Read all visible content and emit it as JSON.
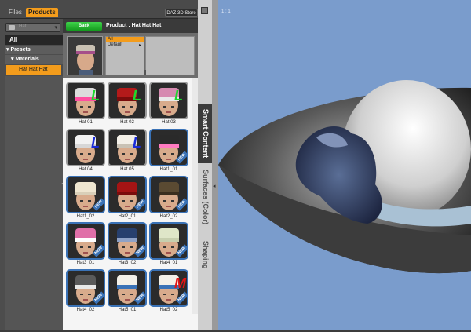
{
  "tabs": {
    "files": "Files",
    "products": "Products"
  },
  "store_button": "DAZ 3D Store",
  "sidebar": {
    "dropdown_value": "Hat",
    "all": "All",
    "presets": "▾ Presets",
    "materials": "▾ Materials",
    "selected_item": "Hat Hat Hat"
  },
  "product": {
    "back_label": "Back",
    "title": "Product : Hat Hat Hat",
    "categories": [
      "All",
      "Default"
    ]
  },
  "items": [
    {
      "label": "Hat 01",
      "hat": "#dcdcdc",
      "band": "#ff4fa0",
      "mark": "L",
      "mark_color": "#1bd82d",
      "new": false
    },
    {
      "label": "Hat 02",
      "hat": "#b31a1a",
      "band": "#7a0c0c",
      "mark": "L",
      "mark_color": "#1bd82d",
      "new": false
    },
    {
      "label": "Hat 03",
      "hat": "#d68ab0",
      "band": "#e9e9e9",
      "mark": "L",
      "mark_color": "#1bd82d",
      "new": false
    },
    {
      "label": "Hat 04",
      "hat": "#f2f2f2",
      "band": "#d7d7d7",
      "mark": "L",
      "mark_color": "#1a2bd8",
      "new": false
    },
    {
      "label": "Hat 05",
      "hat": "#f3f0e8",
      "band": "#c9c2b4",
      "mark": "L",
      "mark_color": "#1a2bd8",
      "new": false
    },
    {
      "label": "Hat1_01",
      "hat": "#2a2a2a",
      "band": "#ff7ac0",
      "mark": "",
      "mark_color": "",
      "new": true
    },
    {
      "label": "Hat1_02",
      "hat": "#efe6d0",
      "band": "#d9cfb8",
      "mark": "",
      "mark_color": "",
      "new": true
    },
    {
      "label": "Hat2_01",
      "hat": "#a51414",
      "band": "#7a0c0c",
      "mark": "",
      "mark_color": "",
      "new": true
    },
    {
      "label": "Hat2_02",
      "hat": "#5a4a32",
      "band": "#3a2e1e",
      "mark": "",
      "mark_color": "",
      "new": true
    },
    {
      "label": "Hat3_01",
      "hat": "#e06fa8",
      "band": "#ffffff",
      "mark": "",
      "mark_color": "",
      "new": true
    },
    {
      "label": "Hat3_02",
      "hat": "#27406e",
      "band": "#8fa2c6",
      "mark": "",
      "mark_color": "",
      "new": true
    },
    {
      "label": "Hat4_01",
      "hat": "#dfe6c8",
      "band": "#c7cfae",
      "mark": "",
      "mark_color": "",
      "new": true
    },
    {
      "label": "Hat4_02",
      "hat": "#5a5a5a",
      "band": "#e8e8e8",
      "mark": "",
      "mark_color": "",
      "new": true
    },
    {
      "label": "Hat5_01",
      "hat": "#f3f0e8",
      "band": "#3a72b6",
      "mark": "",
      "mark_color": "",
      "new": true
    },
    {
      "label": "Hat5_02",
      "hat": "#f3f0e8",
      "band": "#3a72b6",
      "mark": "M",
      "mark_color": "#e01515",
      "new": true
    }
  ],
  "badge_text": "NEW",
  "vertical_tabs": {
    "smart": "Smart Content",
    "surfaces": "Surfaces (Color)",
    "shaping": "Shaping"
  },
  "viewport_label": "1 : 1",
  "colors": {
    "accent": "#f39c1c",
    "back_green": "#27b833",
    "viewport_bg": "#7a9ccc",
    "new_badge": "#3a72b6"
  }
}
